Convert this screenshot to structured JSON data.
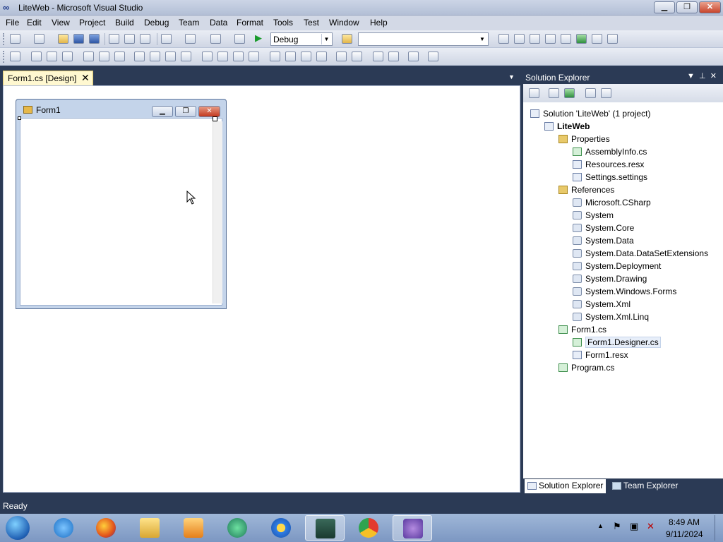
{
  "window": {
    "title": "LiteWeb - Microsoft Visual Studio"
  },
  "menu": [
    "File",
    "Edit",
    "View",
    "Project",
    "Build",
    "Debug",
    "Team",
    "Data",
    "Format",
    "Tools",
    "Test",
    "Window",
    "Help"
  ],
  "toolbar": {
    "config_value": "Debug",
    "platform_value": ""
  },
  "document_tab": {
    "label": "Form1.cs [Design]"
  },
  "form": {
    "title": "Form1"
  },
  "solution_explorer": {
    "title": "Solution Explorer",
    "tree": [
      {
        "label": "Solution 'LiteWeb' (1 project)",
        "level": 0
      },
      {
        "label": "LiteWeb",
        "level": 1,
        "bold": true
      },
      {
        "label": "Properties",
        "level": 2
      },
      {
        "label": "AssemblyInfo.cs",
        "level": 3
      },
      {
        "label": "Resources.resx",
        "level": 3
      },
      {
        "label": "Settings.settings",
        "level": 3
      },
      {
        "label": "References",
        "level": 2
      },
      {
        "label": "Microsoft.CSharp",
        "level": 3
      },
      {
        "label": "System",
        "level": 3
      },
      {
        "label": "System.Core",
        "level": 3
      },
      {
        "label": "System.Data",
        "level": 3
      },
      {
        "label": "System.Data.DataSetExtensions",
        "level": 3
      },
      {
        "label": "System.Deployment",
        "level": 3
      },
      {
        "label": "System.Drawing",
        "level": 3
      },
      {
        "label": "System.Windows.Forms",
        "level": 3
      },
      {
        "label": "System.Xml",
        "level": 3
      },
      {
        "label": "System.Xml.Linq",
        "level": 3
      },
      {
        "label": "Form1.cs",
        "level": 2
      },
      {
        "label": "Form1.Designer.cs",
        "level": 3,
        "selected": true
      },
      {
        "label": "Form1.resx",
        "level": 3
      },
      {
        "label": "Program.cs",
        "level": 2
      }
    ],
    "tabs": {
      "solution": "Solution Explorer",
      "team": "Team Explorer"
    }
  },
  "status": {
    "text": "Ready"
  },
  "taskbar": {
    "time": "8:49 AM",
    "date": "9/11/2024",
    "apps": [
      "internet-explorer-icon",
      "firefox-icon",
      "file-explorer-icon",
      "media-player-icon",
      "app-icon",
      "browser-icon",
      "monitor-icon",
      "chrome-icon",
      "visual-studio-icon"
    ]
  },
  "colors": {
    "accent": "#2b3a55",
    "tab_active": "#fff8d0"
  }
}
